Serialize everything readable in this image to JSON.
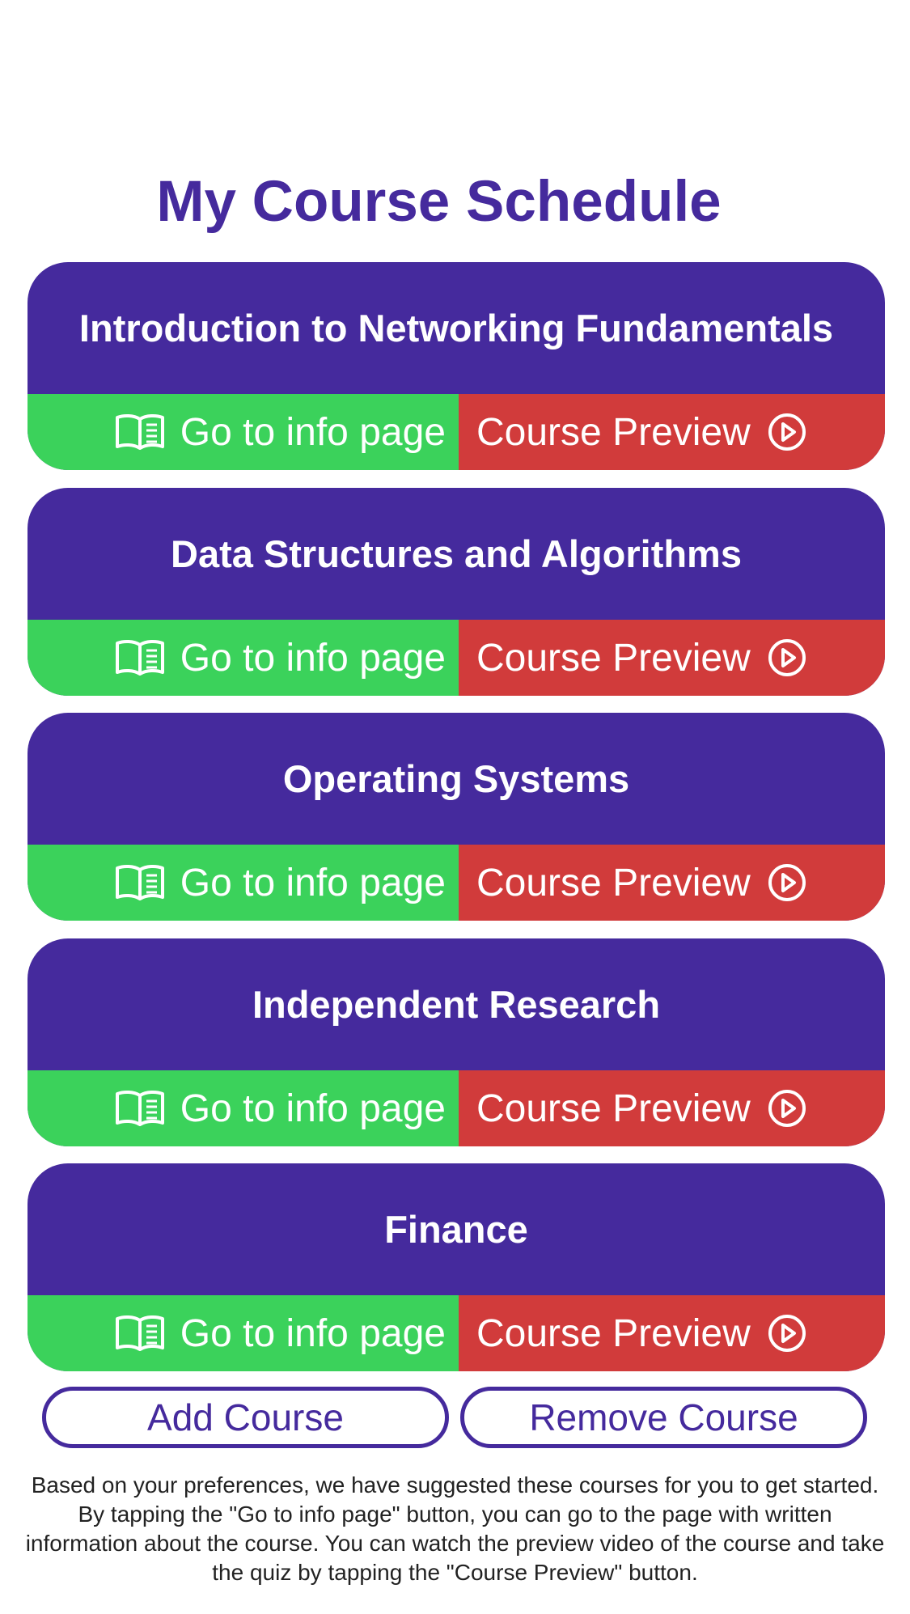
{
  "header": {
    "title": "My Course Schedule"
  },
  "courses": [
    {
      "title": "Introduction to Networking Fundamentals",
      "info_label": "Go to info page",
      "preview_label": "Course Preview"
    },
    {
      "title": "Data Structures and Algorithms",
      "info_label": "Go to info page",
      "preview_label": "Course Preview"
    },
    {
      "title": "Operating Systems",
      "info_label": "Go to info page",
      "preview_label": "Course Preview"
    },
    {
      "title": "Independent Research",
      "info_label": "Go to info page",
      "preview_label": "Course Preview"
    },
    {
      "title": "Finance",
      "info_label": "Go to info page",
      "preview_label": "Course Preview"
    }
  ],
  "actions": {
    "add_label": "Add Course",
    "remove_label": "Remove Course"
  },
  "footer": {
    "note": "Based on your preferences, we have suggested these courses for you to get started. By tapping the \"Go to info page\" button, you can go to the page with written information about the course. You can watch the preview video of the course and take the quiz by tapping the \"Course Preview\" button."
  },
  "icons": {
    "info": "book-open-icon",
    "preview": "play-circle-icon"
  },
  "colors": {
    "brand": "#452a9d",
    "info_button": "#3bd25b",
    "preview_button": "#d13b3b",
    "text_light": "#ffffff"
  }
}
